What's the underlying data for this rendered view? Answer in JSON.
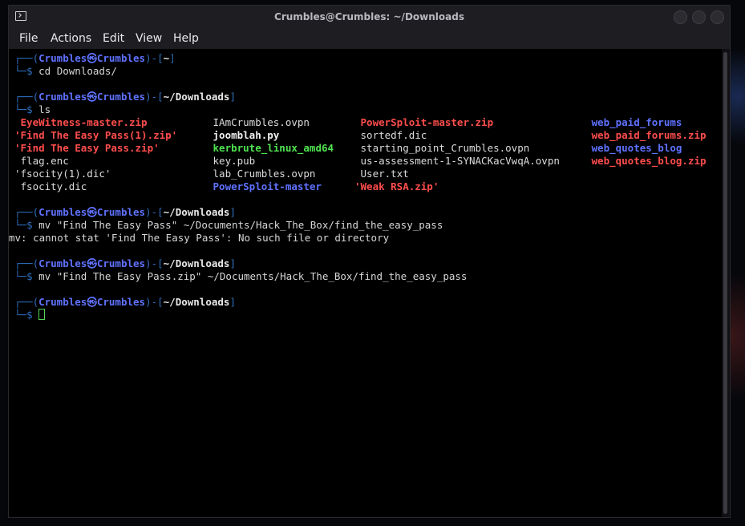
{
  "window": {
    "title": "Crumbles@Crumbles: ~/Downloads"
  },
  "menu": [
    "File",
    "Actions",
    "Edit",
    "View",
    "Help"
  ],
  "prompt": {
    "open": "┌──(",
    "user": "Crumbles",
    "at": "㉿",
    "host": "Crumbles",
    "mid": ")-[",
    "close": "]",
    "corner": "└─",
    "dollar": "$"
  },
  "session": [
    {
      "dir": "~",
      "command": "cd Downloads/"
    },
    {
      "dir": "~/Downloads",
      "command": "ls"
    },
    {
      "dir": "~/Downloads",
      "command": "mv \"Find The Easy Pass\" ~/Documents/Hack_The_Box/find_the_easy_pass",
      "output": "mv: cannot stat 'Find The Easy Pass': No such file or directory"
    },
    {
      "dir": "~/Downloads",
      "command": "mv \"Find The Easy Pass.zip\" ~/Documents/Hack_The_Box/find_the_easy_pass"
    },
    {
      "dir": "~/Downloads",
      "command": ""
    }
  ],
  "ls_listing": [
    [
      " EyeWitness-master.zip",
      " IAmCrumbles.ovpn",
      " PowerSploit-master.zip",
      " web_paid_forums"
    ],
    [
      "'Find The Easy Pass(1).zip'",
      " joomblah.py",
      " sortedf.dic",
      " web_paid_forums.zip"
    ],
    [
      "'Find The Easy Pass.zip'",
      " kerbrute_linux_amd64",
      " starting_point_Crumbles.ovpn",
      " web_quotes_blog"
    ],
    [
      " flag.enc",
      " key.pub",
      " us-assessment-1-SYNACKacVwqA.ovpn",
      " web_quotes_blog.zip"
    ],
    [
      "'fsocity(1).dic'",
      " lab_Crumbles.ovpn",
      " User.txt",
      ""
    ],
    [
      " fsocity.dic",
      " PowerSploit-master",
      "'Weak RSA.zip'",
      ""
    ]
  ],
  "ls_colors": [
    [
      "red",
      "white",
      "red",
      "blue"
    ],
    [
      "red",
      "bold",
      "white",
      "red"
    ],
    [
      "red",
      "green",
      "white",
      "blue"
    ],
    [
      "white",
      "white",
      "white",
      "red"
    ],
    [
      "white",
      "white",
      "white",
      ""
    ],
    [
      "white",
      "blue",
      "red",
      ""
    ]
  ]
}
